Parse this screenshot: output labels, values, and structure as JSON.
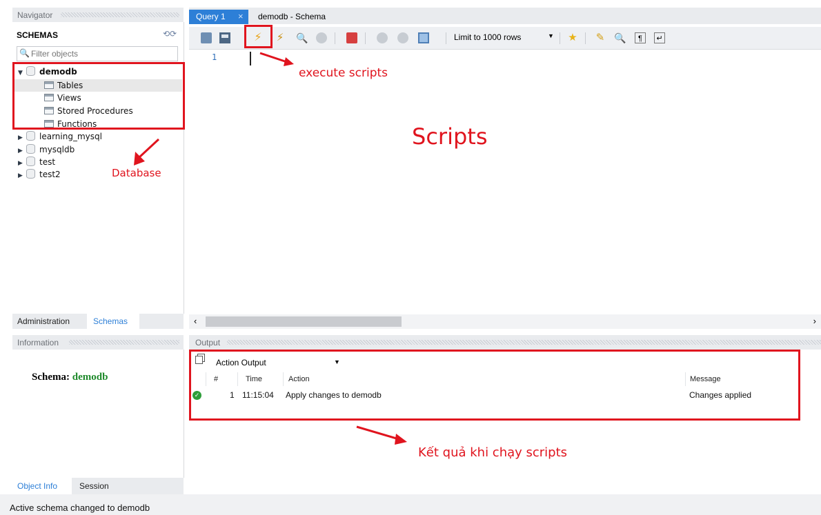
{
  "navigator": {
    "title": "Navigator",
    "schemas_label": "SCHEMAS",
    "filter_placeholder": "Filter objects",
    "tree": {
      "selected": "demodb",
      "selected_children": [
        "Tables",
        "Views",
        "Stored Procedures",
        "Functions"
      ],
      "others": [
        "learning_mysql",
        "mysqldb",
        "test",
        "test2"
      ]
    },
    "tabs": [
      "Administration",
      "Schemas"
    ],
    "active_tab": "Schemas"
  },
  "information": {
    "title": "Information",
    "schema_label": "Schema:",
    "schema_value": "demodb",
    "tabs": [
      "Object Info",
      "Session"
    ]
  },
  "editor": {
    "tabs": [
      "Query 1",
      "demodb - Schema"
    ],
    "active_tab": "Query 1",
    "close_glyph": "×",
    "limit_label": "Limit to 1000 rows",
    "line_numbers": [
      "1"
    ]
  },
  "output": {
    "title": "Output",
    "selector": "Action Output",
    "columns": [
      "#",
      "Time",
      "Action",
      "Message"
    ],
    "rows": [
      {
        "num": "1",
        "time": "11:15:04",
        "action": "Apply changes to demodb",
        "message": "Changes applied",
        "status": "success"
      }
    ]
  },
  "status_bar": {
    "text": "Active schema changed to demodb"
  },
  "annotations": {
    "execute": "execute scripts",
    "scripts": "Scripts",
    "database": "Database",
    "result": "Kết quả khi chạy scripts",
    "color": "#e0141e"
  }
}
